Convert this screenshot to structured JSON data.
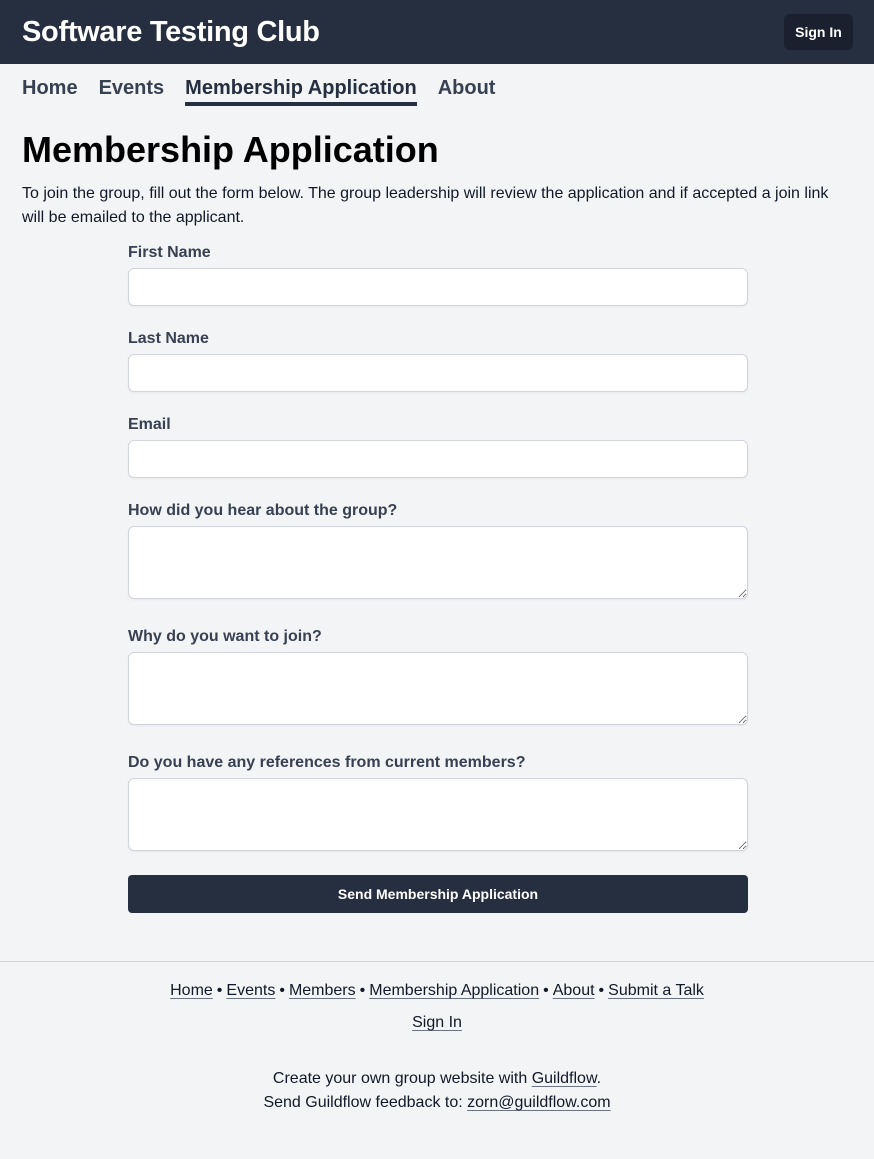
{
  "header": {
    "site_title": "Software Testing Club",
    "sign_in_label": "Sign In"
  },
  "nav": {
    "items": [
      {
        "label": "Home",
        "active": false
      },
      {
        "label": "Events",
        "active": false
      },
      {
        "label": "Membership Application",
        "active": true
      },
      {
        "label": "About",
        "active": false
      }
    ]
  },
  "main": {
    "title": "Membership Application",
    "intro": "To join the group, fill out the form below. The group leadership will review the application and if accepted a join link will be emailed to the applicant.",
    "form": {
      "first_name_label": "First Name",
      "first_name_value": "",
      "last_name_label": "Last Name",
      "last_name_value": "",
      "email_label": "Email",
      "email_value": "",
      "hear_label": "How did you hear about the group?",
      "why_label": "Why do you want to join?",
      "references_label": "Do you have any references from current members?",
      "submit_label": "Send Membership Application"
    }
  },
  "footer": {
    "links": [
      "Home",
      "Events",
      "Members",
      "Membership Application",
      "About",
      "Submit a Talk"
    ],
    "separator": "•",
    "sign_in_label": "Sign In",
    "credit_prefix": "Create your own group website with ",
    "credit_link": "Guildflow",
    "credit_suffix": ".",
    "feedback_prefix": "Send Guildflow feedback to: ",
    "feedback_email": "zorn@guildflow.com"
  },
  "colors": {
    "header_bg": "#252f3f",
    "page_bg": "#f3f4f6",
    "button_bg": "#252f3f"
  }
}
